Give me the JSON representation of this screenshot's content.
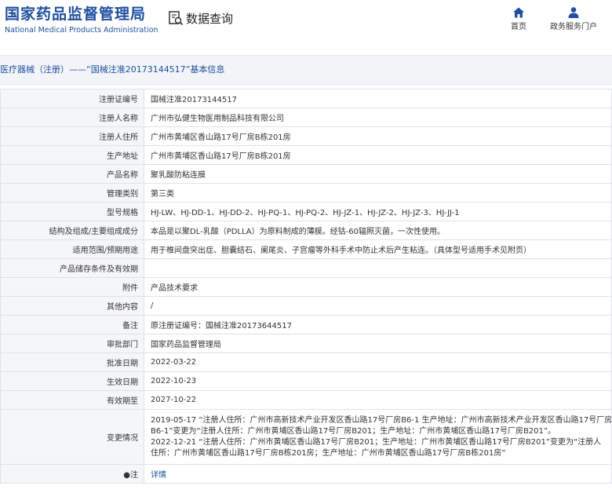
{
  "header": {
    "logo_cn": "国家药品监督管理局",
    "logo_en": "National Medical Products Administration",
    "search_title": "数据查询",
    "nav": [
      {
        "label": "首页",
        "icon": "home-icon"
      },
      {
        "label": "政务服务门户",
        "icon": "user-icon"
      }
    ]
  },
  "breadcrumb": "医疗器械（注册）——“国械注准20173144517”基本信息",
  "rows": [
    {
      "label": "注册证编号",
      "value": "国械注准20173144517"
    },
    {
      "label": "注册人名称",
      "value": "广州市弘健生物医用制品科技有限公司"
    },
    {
      "label": "注册人住所",
      "value": "广州市黄埔区香山路17号厂房B栋201房"
    },
    {
      "label": "生产地址",
      "value": "广州市黄埔区香山路17号厂房B栋201房"
    },
    {
      "label": "产品名称",
      "value": "聚乳酸防粘连膜"
    },
    {
      "label": "管理类别",
      "value": "第三类"
    },
    {
      "label": "型号规格",
      "value": "HJ-LW、HJ-DD-1、HJ-DD-2、HJ-PQ-1、HJ-PQ-2、HJ-JZ-1、HJ-JZ-2、HJ-JZ-3、HJ-JJ-1"
    },
    {
      "label": "结构及组成/主要组成成分",
      "value": "本品是以聚DL-乳酸（PDLLA）为原料制成的薄膜。经钴-60辐照灭菌，一次性使用。"
    },
    {
      "label": "适用范围/预期用途",
      "value": "用于椎间盘突出症、胆囊结石、阑尾炎、子宫瘤等外科手术中防止术后产生粘连。（具体型号适用手术见附页）"
    },
    {
      "label": "产品储存条件及有效期",
      "value": ""
    },
    {
      "label": "附件",
      "value": "产品技术要求"
    },
    {
      "label": "其他内容",
      "value": "/"
    },
    {
      "label": "备注",
      "value": "原注册证编号：国械注准20173644517"
    },
    {
      "label": "审批部门",
      "value": "国家药品监督管理局"
    },
    {
      "label": "批准日期",
      "value": "2022-03-22"
    },
    {
      "label": "生效日期",
      "value": "2022-10-23"
    },
    {
      "label": "有效期至",
      "value": "2027-10-22"
    }
  ],
  "change": {
    "label": "变更情况",
    "lines": [
      "2019-05-17 “注册人住所：广州市高新技术产业开发区香山路17号厂房B6-1 生产地址：广州市高新技术产业开发区香山路17号厂房",
      "B6-1”变更为“注册人住所：广州市黄埔区香山路17号厂房B201；生产地址：广州市黄埔区香山路17号厂房B201”。",
      "2022-12-21 “注册人住所：广州市黄埔区香山路17号厂房B201；生产地址：广州市黄埔区香山路17号厂房B201”变更为“注册人",
      "住所：广州市黄埔区香山路17号厂房B栋201房；生产地址：广州市黄埔区香山路17号厂房B栋201房”"
    ]
  },
  "note": {
    "label": "注",
    "link": "详情"
  }
}
